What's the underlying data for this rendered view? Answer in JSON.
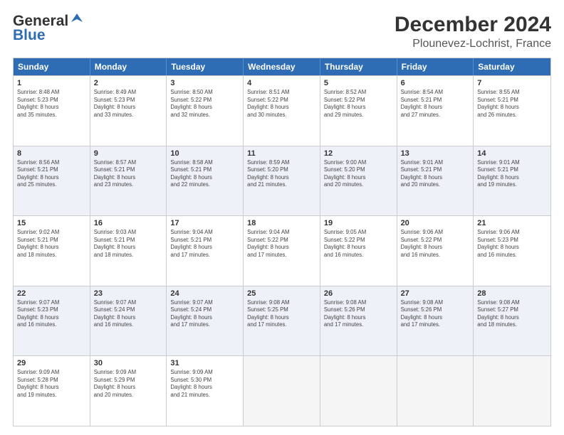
{
  "logo": {
    "line1": "General",
    "line2": "Blue"
  },
  "header": {
    "month": "December 2024",
    "location": "Plounevez-Lochrist, France"
  },
  "days": [
    "Sunday",
    "Monday",
    "Tuesday",
    "Wednesday",
    "Thursday",
    "Friday",
    "Saturday"
  ],
  "weeks": [
    [
      {
        "num": "1",
        "info": "Sunrise: 8:48 AM\nSunset: 5:23 PM\nDaylight: 8 hours\nand 35 minutes."
      },
      {
        "num": "2",
        "info": "Sunrise: 8:49 AM\nSunset: 5:23 PM\nDaylight: 8 hours\nand 33 minutes."
      },
      {
        "num": "3",
        "info": "Sunrise: 8:50 AM\nSunset: 5:22 PM\nDaylight: 8 hours\nand 32 minutes."
      },
      {
        "num": "4",
        "info": "Sunrise: 8:51 AM\nSunset: 5:22 PM\nDaylight: 8 hours\nand 30 minutes."
      },
      {
        "num": "5",
        "info": "Sunrise: 8:52 AM\nSunset: 5:22 PM\nDaylight: 8 hours\nand 29 minutes."
      },
      {
        "num": "6",
        "info": "Sunrise: 8:54 AM\nSunset: 5:21 PM\nDaylight: 8 hours\nand 27 minutes."
      },
      {
        "num": "7",
        "info": "Sunrise: 8:55 AM\nSunset: 5:21 PM\nDaylight: 8 hours\nand 26 minutes."
      }
    ],
    [
      {
        "num": "8",
        "info": "Sunrise: 8:56 AM\nSunset: 5:21 PM\nDaylight: 8 hours\nand 25 minutes."
      },
      {
        "num": "9",
        "info": "Sunrise: 8:57 AM\nSunset: 5:21 PM\nDaylight: 8 hours\nand 23 minutes."
      },
      {
        "num": "10",
        "info": "Sunrise: 8:58 AM\nSunset: 5:21 PM\nDaylight: 8 hours\nand 22 minutes."
      },
      {
        "num": "11",
        "info": "Sunrise: 8:59 AM\nSunset: 5:20 PM\nDaylight: 8 hours\nand 21 minutes."
      },
      {
        "num": "12",
        "info": "Sunrise: 9:00 AM\nSunset: 5:20 PM\nDaylight: 8 hours\nand 20 minutes."
      },
      {
        "num": "13",
        "info": "Sunrise: 9:01 AM\nSunset: 5:21 PM\nDaylight: 8 hours\nand 20 minutes."
      },
      {
        "num": "14",
        "info": "Sunrise: 9:01 AM\nSunset: 5:21 PM\nDaylight: 8 hours\nand 19 minutes."
      }
    ],
    [
      {
        "num": "15",
        "info": "Sunrise: 9:02 AM\nSunset: 5:21 PM\nDaylight: 8 hours\nand 18 minutes."
      },
      {
        "num": "16",
        "info": "Sunrise: 9:03 AM\nSunset: 5:21 PM\nDaylight: 8 hours\nand 18 minutes."
      },
      {
        "num": "17",
        "info": "Sunrise: 9:04 AM\nSunset: 5:21 PM\nDaylight: 8 hours\nand 17 minutes."
      },
      {
        "num": "18",
        "info": "Sunrise: 9:04 AM\nSunset: 5:22 PM\nDaylight: 8 hours\nand 17 minutes."
      },
      {
        "num": "19",
        "info": "Sunrise: 9:05 AM\nSunset: 5:22 PM\nDaylight: 8 hours\nand 16 minutes."
      },
      {
        "num": "20",
        "info": "Sunrise: 9:06 AM\nSunset: 5:22 PM\nDaylight: 8 hours\nand 16 minutes."
      },
      {
        "num": "21",
        "info": "Sunrise: 9:06 AM\nSunset: 5:23 PM\nDaylight: 8 hours\nand 16 minutes."
      }
    ],
    [
      {
        "num": "22",
        "info": "Sunrise: 9:07 AM\nSunset: 5:23 PM\nDaylight: 8 hours\nand 16 minutes."
      },
      {
        "num": "23",
        "info": "Sunrise: 9:07 AM\nSunset: 5:24 PM\nDaylight: 8 hours\nand 16 minutes."
      },
      {
        "num": "24",
        "info": "Sunrise: 9:07 AM\nSunset: 5:24 PM\nDaylight: 8 hours\nand 17 minutes."
      },
      {
        "num": "25",
        "info": "Sunrise: 9:08 AM\nSunset: 5:25 PM\nDaylight: 8 hours\nand 17 minutes."
      },
      {
        "num": "26",
        "info": "Sunrise: 9:08 AM\nSunset: 5:26 PM\nDaylight: 8 hours\nand 17 minutes."
      },
      {
        "num": "27",
        "info": "Sunrise: 9:08 AM\nSunset: 5:26 PM\nDaylight: 8 hours\nand 17 minutes."
      },
      {
        "num": "28",
        "info": "Sunrise: 9:08 AM\nSunset: 5:27 PM\nDaylight: 8 hours\nand 18 minutes."
      }
    ],
    [
      {
        "num": "29",
        "info": "Sunrise: 9:09 AM\nSunset: 5:28 PM\nDaylight: 8 hours\nand 19 minutes."
      },
      {
        "num": "30",
        "info": "Sunrise: 9:09 AM\nSunset: 5:29 PM\nDaylight: 8 hours\nand 20 minutes."
      },
      {
        "num": "31",
        "info": "Sunrise: 9:09 AM\nSunset: 5:30 PM\nDaylight: 8 hours\nand 21 minutes."
      },
      {
        "num": "",
        "info": ""
      },
      {
        "num": "",
        "info": ""
      },
      {
        "num": "",
        "info": ""
      },
      {
        "num": "",
        "info": ""
      }
    ]
  ]
}
